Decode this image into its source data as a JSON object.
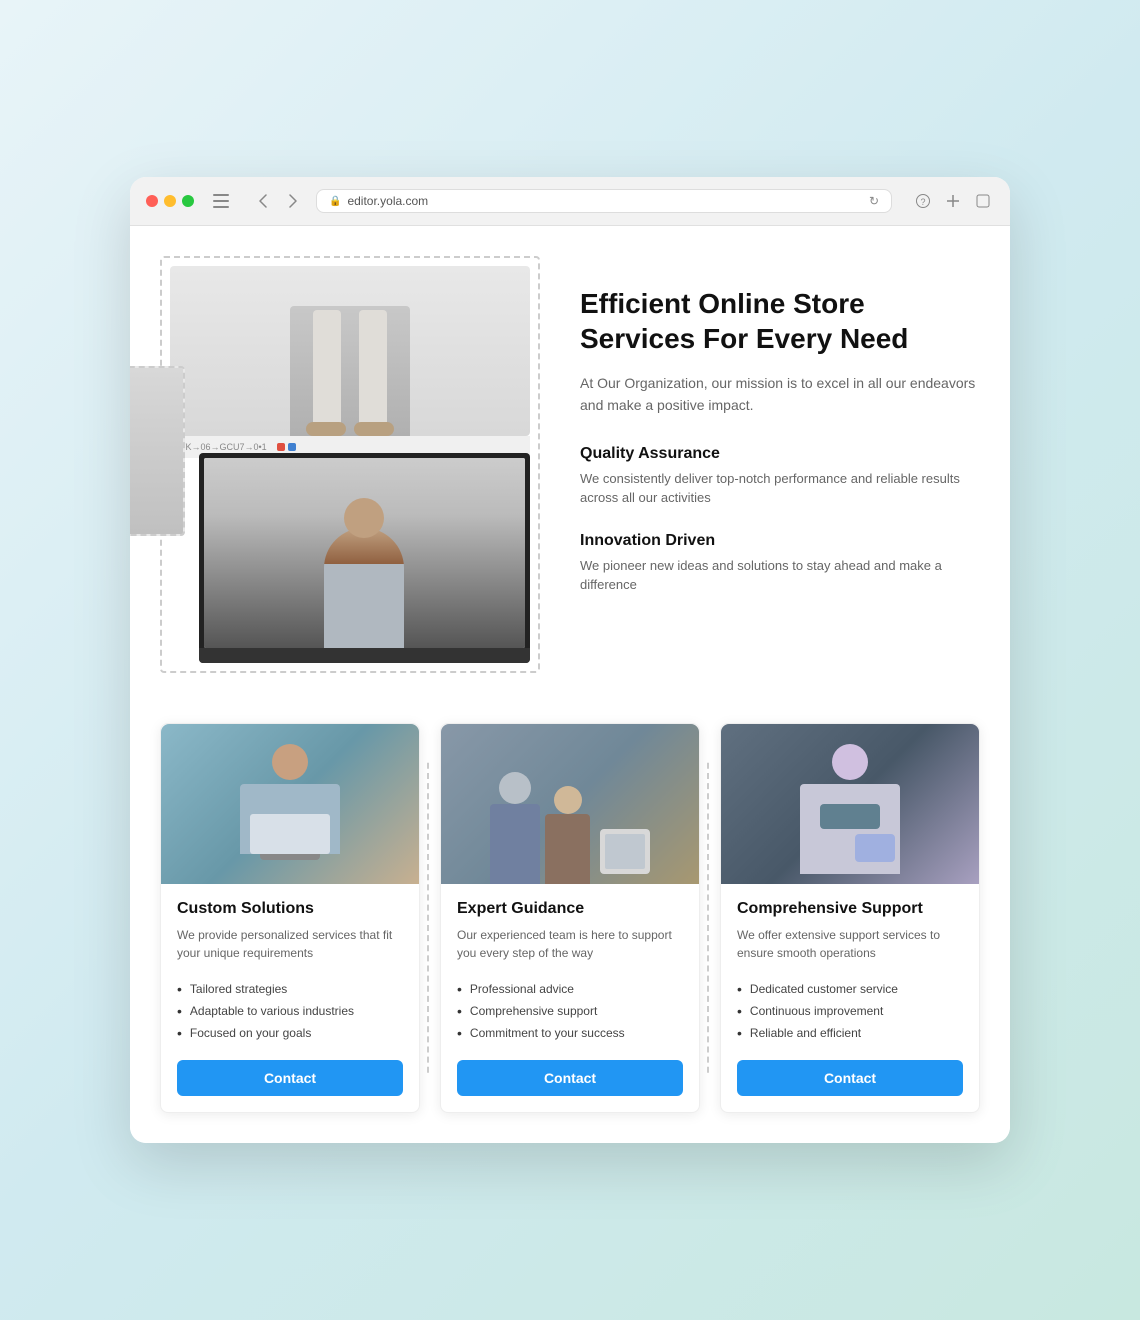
{
  "browser": {
    "url": "editor.yola.com",
    "back_label": "‹",
    "forward_label": "›",
    "sidebar_label": "⊞",
    "reload_label": "↻",
    "share_label": "↗",
    "extensions_label": "⊕"
  },
  "hero": {
    "title": "Efficient Online Store Services For Every Need",
    "subtitle": "At Our Organization, our mission is to excel in all our endeavors and make a positive impact.",
    "features": [
      {
        "id": "quality",
        "title": "Quality Assurance",
        "description": "We consistently deliver top-notch performance and reliable results across all our activities"
      },
      {
        "id": "innovation",
        "title": "Innovation Driven",
        "description": "We pioneer new ideas and solutions to stay ahead and make a difference"
      }
    ]
  },
  "cards": [
    {
      "id": "custom-solutions",
      "title": "Custom Solutions",
      "description": "We provide personalized services that fit your unique requirements",
      "list_items": [
        "Tailored strategies",
        "Adaptable to various industries",
        "Focused on your goals"
      ],
      "button_label": "Contact"
    },
    {
      "id": "expert-guidance",
      "title": "Expert Guidance",
      "description": "Our experienced team is here to support you every step of the way",
      "list_items": [
        "Professional advice",
        "Comprehensive support",
        "Commitment to your success"
      ],
      "button_label": "Contact"
    },
    {
      "id": "comprehensive-support",
      "title": "Comprehensive Support",
      "description": "We offer extensive support services to ensure smooth operations",
      "list_items": [
        "Dedicated customer service",
        "Continuous improvement",
        "Reliable and efficient"
      ],
      "button_label": "Contact"
    }
  ],
  "colors": {
    "accent": "#2196F3",
    "text_dark": "#111111",
    "text_muted": "#666666"
  }
}
